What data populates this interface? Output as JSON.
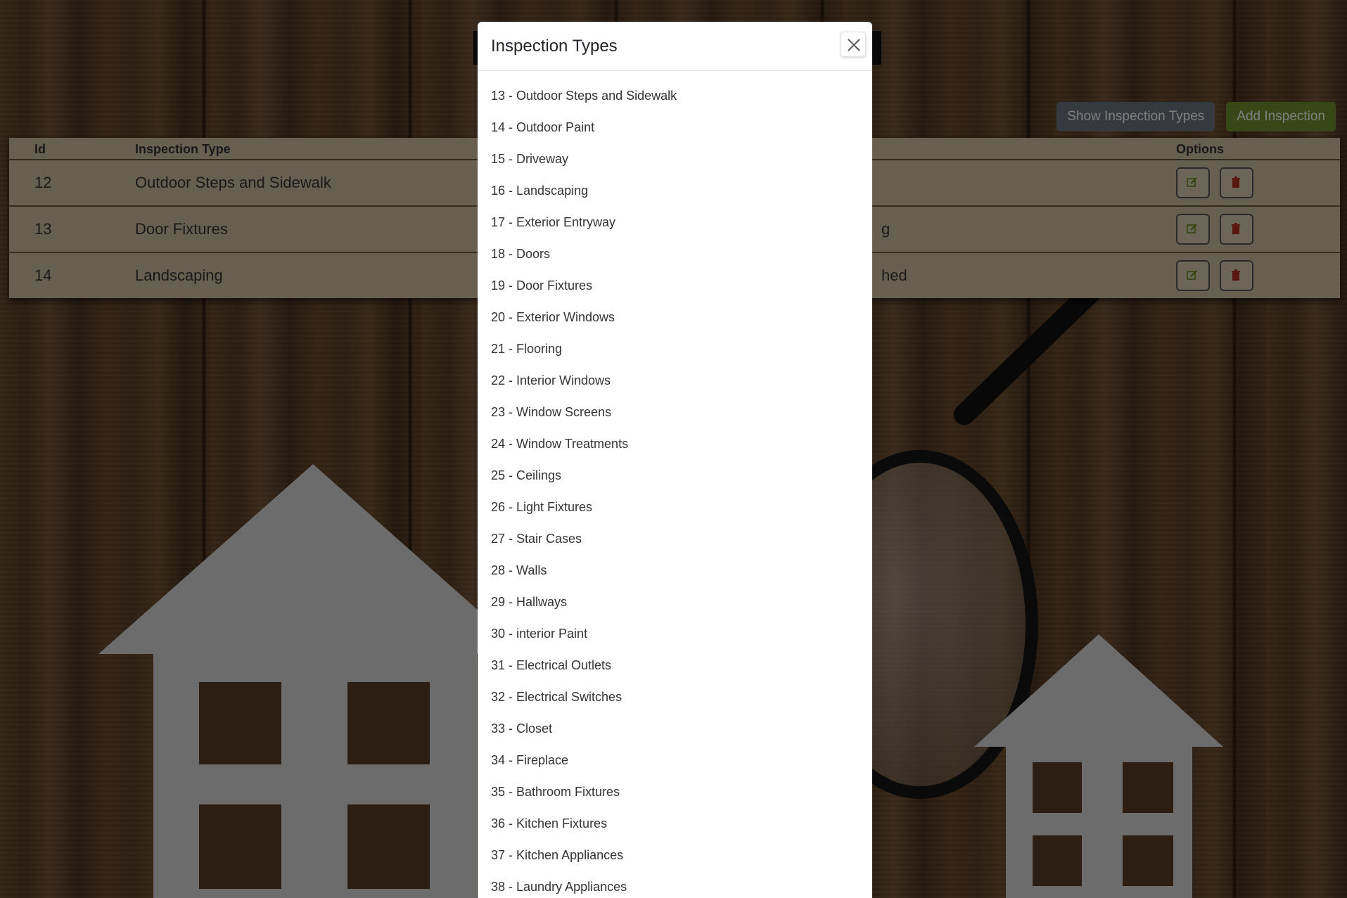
{
  "header": {
    "show_types_label": "Show Inspection Types",
    "add_inspection_label": "Add Inspection"
  },
  "table": {
    "columns": [
      "Id",
      "Inspection Type",
      "Options"
    ],
    "rows": [
      {
        "id": "12",
        "type": "Outdoor Steps and Sidewalk",
        "status": ""
      },
      {
        "id": "13",
        "type": "Door Fixtures",
        "status": "g"
      },
      {
        "id": "14",
        "type": "Landscaping",
        "status": "hed"
      }
    ]
  },
  "modal": {
    "title": "Inspection Types",
    "items": [
      "13 - Outdoor Steps and Sidewalk",
      "14 - Outdoor Paint",
      "15 - Driveway",
      "16 - Landscaping",
      "17 - Exterior Entryway",
      "18 - Doors",
      "19 - Door Fixtures",
      "20 - Exterior Windows",
      "21 - Flooring",
      "22 - Interior Windows",
      "23 - Window Screens",
      "24 - Window Treatments",
      "25 - Ceilings",
      "26 - Light Fixtures",
      "27 - Stair Cases",
      "28 - Walls",
      "29 - Hallways",
      "30 - interior Paint",
      "31 - Electrical Outlets",
      "32 - Electrical Switches",
      "33 - Closet",
      "34 - Fireplace",
      "35 - Bathroom Fixtures",
      "36 - Kitchen Fixtures",
      "37 - Kitchen Appliances",
      "38 - Laundry Appliances"
    ]
  },
  "colors": {
    "show_button": "#6c757d",
    "add_button": "#6f8f2e",
    "edit_icon": "#5a8a1a",
    "delete_icon": "#b03020"
  },
  "icons": [
    "edit-icon",
    "trash-icon",
    "close-icon"
  ]
}
